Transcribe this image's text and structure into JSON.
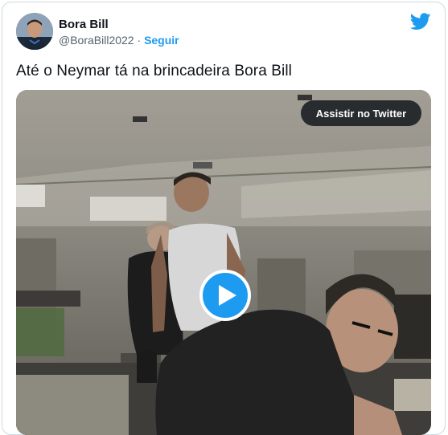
{
  "account": {
    "display_name": "Bora Bill",
    "handle": "@BoraBill2022",
    "separator": "·",
    "follow_label": "Seguir"
  },
  "tweet": {
    "text": "Até o Neymar tá na brincadeira Bora Bill"
  },
  "media": {
    "watch_label": "Assistir no Twitter"
  },
  "icons": {
    "brand": "twitter-bird-icon",
    "play": "play-icon"
  },
  "colors": {
    "twitter_blue": "#1d9bf0",
    "text_primary": "#0f1419",
    "text_secondary": "#536471"
  }
}
